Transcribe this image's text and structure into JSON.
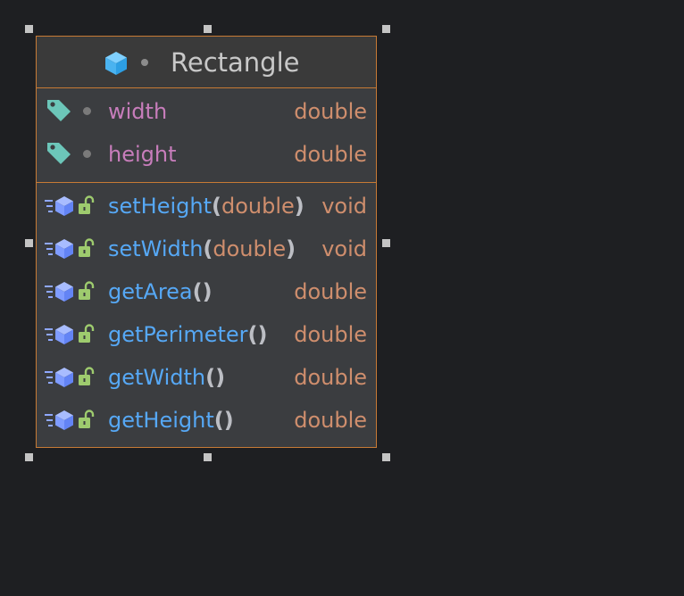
{
  "diagram": {
    "class_name": "Rectangle",
    "fields": [
      {
        "name": "width",
        "type": "double"
      },
      {
        "name": "height",
        "type": "double"
      }
    ],
    "methods": [
      {
        "name": "setHeight",
        "open": "(",
        "param": "double",
        "close": ")",
        "return": "void"
      },
      {
        "name": "setWidth",
        "open": "(",
        "param": "double",
        "close": ")",
        "return": "void"
      },
      {
        "name": "getArea",
        "open": "(",
        "param": "",
        "close": ")",
        "return": "double"
      },
      {
        "name": "getPerimeter",
        "open": "(",
        "param": "",
        "close": ")",
        "return": "double"
      },
      {
        "name": "getWidth",
        "open": "(",
        "param": "",
        "close": ")",
        "return": "double"
      },
      {
        "name": "getHeight",
        "open": "(",
        "param": "",
        "close": ")",
        "return": "double"
      }
    ]
  },
  "icons": {
    "class": "class-cube-icon",
    "field": "field-tag-icon",
    "method": "method-cube-icon",
    "lock": "unlocked-padlock-icon"
  },
  "colors": {
    "background": "#1e1f22",
    "class_fill": "#3b3d40",
    "border": "#c77a35",
    "field_name": "#c77dbb",
    "method_name": "#56a8f5",
    "type": "#cf8e6d"
  }
}
